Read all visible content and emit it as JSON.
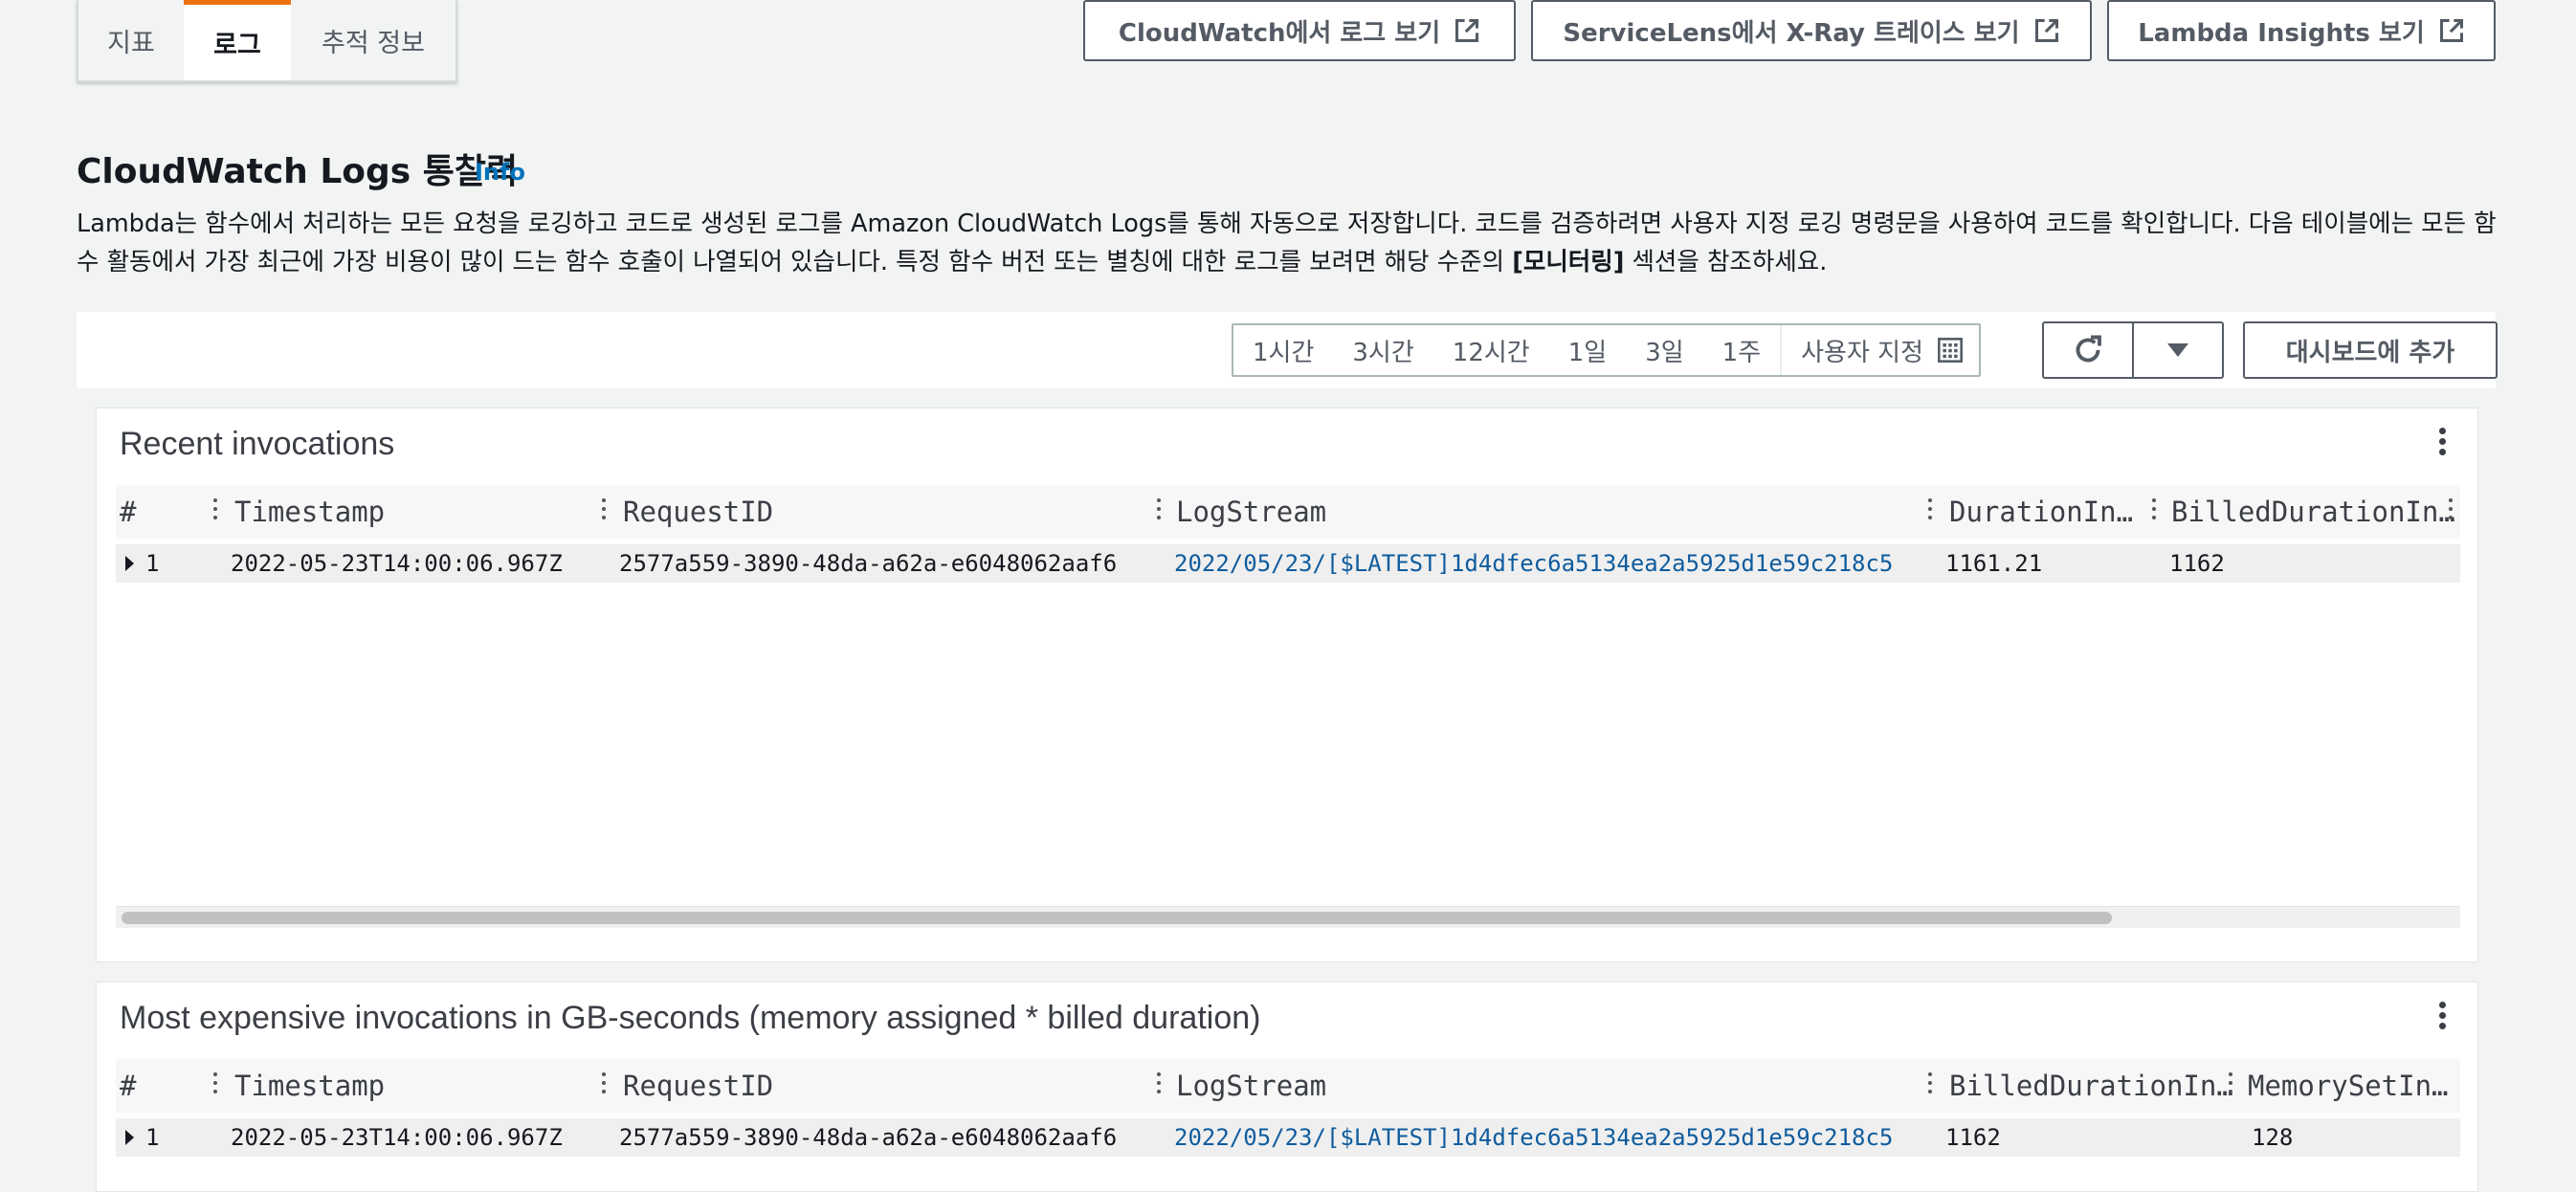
{
  "tabs": [
    {
      "label": "지표"
    },
    {
      "label": "로그",
      "active": true
    },
    {
      "label": "추적 정보"
    }
  ],
  "external_buttons": [
    {
      "label": "CloudWatch에서 로그 보기"
    },
    {
      "label": "ServiceLens에서 X-Ray 트레이스 보기"
    },
    {
      "label": "Lambda Insights 보기"
    }
  ],
  "section": {
    "title": "CloudWatch Logs 통찰력",
    "info_link": "Info",
    "description_pre": "Lambda는 함수에서 처리하는 모든 요청을 로깅하고 코드로 생성된 로그를 Amazon CloudWatch Logs를 통해 자동으로 저장합니다. 코드를 검증하려면 사용자 지정 로깅 명령문을 사용하여 코드를 확인합니다. 다음 테이블에는 모든 함수 활동에서 가장 최근에 가장 비용이 많이 드는 함수 호출이 나열되어 있습니다. 특정 함수 버전 또는 별칭에 대한 로그를 보려면 해당 수준의 ",
    "description_bold": "[모니터링]",
    "description_post": " 섹션을 참조하세요."
  },
  "time_range": {
    "options": [
      "1시간",
      "3시간",
      "12시간",
      "1일",
      "3일",
      "1주"
    ],
    "custom_label": "사용자 지정"
  },
  "add_to_dashboard_label": "대시보드에 추가",
  "widgets": {
    "recent": {
      "title": "Recent invocations",
      "columns": [
        "#",
        "Timestamp",
        "RequestID",
        "LogStream",
        "DurationIn…",
        "BilledDurationIn…"
      ],
      "rows": [
        [
          "1",
          "2022-05-23T14:00:06.967Z",
          "2577a559-3890-48da-a62a-e6048062aaf6",
          "2022/05/23/[$LATEST]1d4dfec6a5134ea2a5925d1e59c218c5",
          "1161.21",
          "1162"
        ]
      ]
    },
    "expensive": {
      "title": "Most expensive invocations in GB-seconds (memory assigned * billed duration)",
      "columns": [
        "#",
        "Timestamp",
        "RequestID",
        "LogStream",
        "BilledDurationIn…",
        "MemorySetIn…"
      ],
      "rows": [
        [
          "1",
          "2022-05-23T14:00:06.967Z",
          "2577a559-3890-48da-a62a-e6048062aaf6",
          "2022/05/23/[$LATEST]1d4dfec6a5134ea2a5925d1e59c218c5",
          "1162",
          "128"
        ]
      ]
    }
  },
  "colors": {
    "accent_tab": "#ec7211",
    "link": "#0073bb",
    "background": "#f2f3f3"
  }
}
